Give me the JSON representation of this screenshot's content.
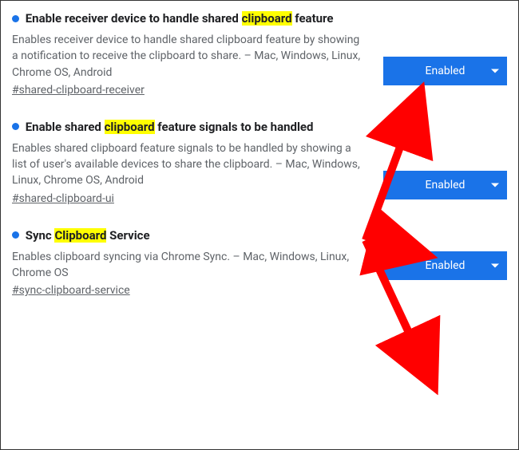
{
  "flags": [
    {
      "title_pre": "Enable receiver device to handle shared ",
      "title_hl": "clipboard",
      "title_post": " feature",
      "desc": "Enables receiver device to handle shared clipboard feature by showing a notification to receive the clipboard to share. – Mac, Windows, Linux, Chrome OS, Android",
      "hash": "#shared-clipboard-receiver",
      "value": "Enabled"
    },
    {
      "title_pre": "Enable shared ",
      "title_hl": "clipboard",
      "title_post": " feature signals to be handled",
      "desc": "Enables shared clipboard feature signals to be handled by showing a list of user's available devices to share the clipboard. – Mac, Windows, Linux, Chrome OS, Android",
      "hash": "#shared-clipboard-ui",
      "value": "Enabled"
    },
    {
      "title_pre": "Sync ",
      "title_hl": "Clipboard",
      "title_post": " Service",
      "desc": "Enables clipboard syncing via Chrome Sync. – Mac, Windows, Linux, Chrome OS",
      "hash": "#sync-clipboard-service",
      "value": "Enabled"
    }
  ]
}
